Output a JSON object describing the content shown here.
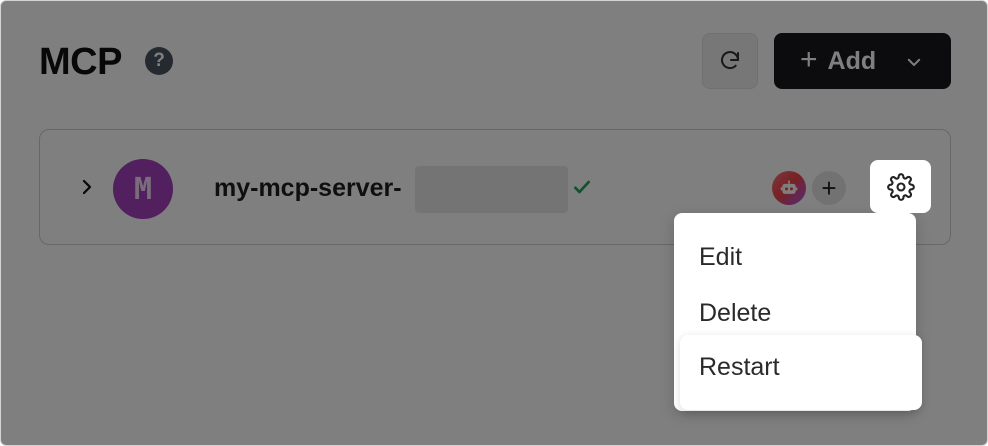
{
  "header": {
    "title": "MCP",
    "help_icon": "question-circle-icon",
    "help_glyph": "?",
    "refresh_icon": "refresh-icon",
    "add_label": "Add",
    "add_plus": "+",
    "add_caret_icon": "chevron-down-icon"
  },
  "server": {
    "expand_icon": "chevron-right-icon",
    "avatar_letter": "M",
    "name": "my-mcp-server-",
    "status_icon": "check-icon",
    "tool_badge_icon": "robot-icon",
    "add_tool_glyph": "+",
    "settings_icon": "gear-icon"
  },
  "menu": {
    "items": [
      {
        "label": "Edit"
      },
      {
        "label": "Delete"
      },
      {
        "label": "Restart"
      }
    ]
  },
  "colors": {
    "avatar_bg": "#a43fbf",
    "primary_button": "#18191d",
    "status_ok": "#22a55b",
    "overlay": "rgba(0,0,0,0.5)"
  }
}
